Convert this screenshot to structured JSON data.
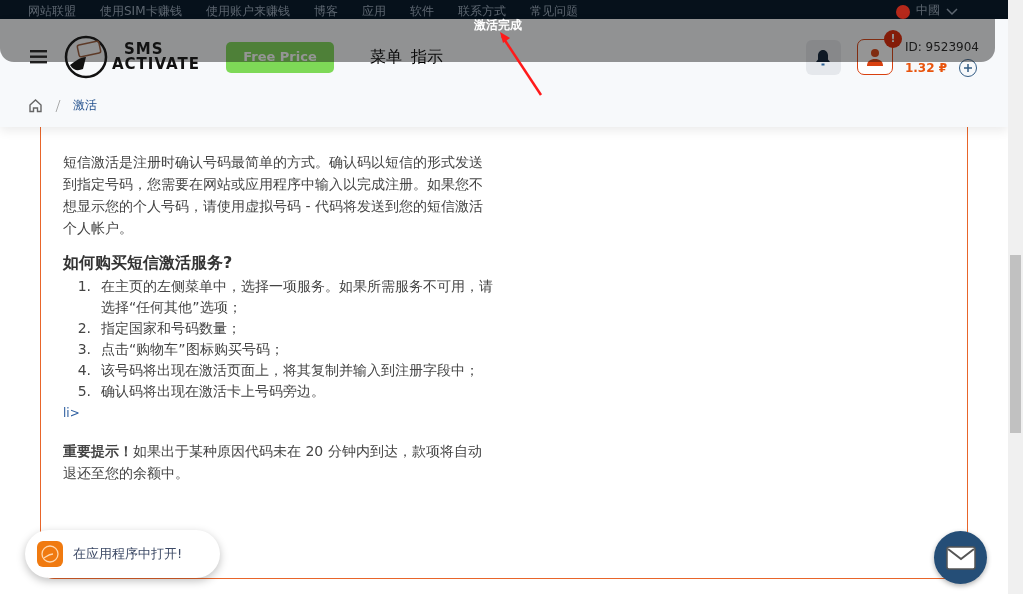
{
  "top_nav": {
    "links": [
      "网站联盟",
      "使用SIM卡赚钱",
      "使用账户来赚钱",
      "博客",
      "应用",
      "软件",
      "联系方式",
      "常见问题"
    ],
    "language": "中國"
  },
  "toast": {
    "message": "激活完成"
  },
  "header": {
    "logo": {
      "line1": "SMS",
      "line2": "ACTIVATE"
    },
    "promo_button": "Free Price",
    "menu_links": [
      "菜单",
      "指示"
    ],
    "account": {
      "alert_badge": "!",
      "id": "ID: 9523904",
      "balance": "1.32 ₽"
    }
  },
  "breadcrumb": [
    {
      "label": "激活"
    }
  ],
  "article": {
    "intro": "短信激活是注册时确认号码最简单的方式。确认码以短信的形式发送到指定号码，您需要在网站或应用程序中输入以完成注册。如果您不想显示您的个人号码，请使用虚拟号码 - 代码将发送到您的短信激活个人帐户。",
    "heading": "如何购买短信激活服务?",
    "steps": [
      {
        "number": "1.",
        "text": "在主页的左侧菜单中，选择一项服务。如果所需服务不可用，请选择“任何其他”选项；"
      },
      {
        "number": "2.",
        "text": "指定国家和号码数量；"
      },
      {
        "number": "3.",
        "text": "点击“购物车”图标购买号码；"
      },
      {
        "number": "4.",
        "text": "该号码将出现在激活页面上，将其复制并输入到注册字段中；"
      },
      {
        "number": "5.",
        "text": "确认码将出现在激活卡上号码旁边。"
      }
    ],
    "stray_text": "li>",
    "notice": "**重要提示！**如果出于某种原因代码未在 20 分钟内到达，款项将自动退还至您的余额中。"
  },
  "open_in_app": "在应用程序中打开!"
}
